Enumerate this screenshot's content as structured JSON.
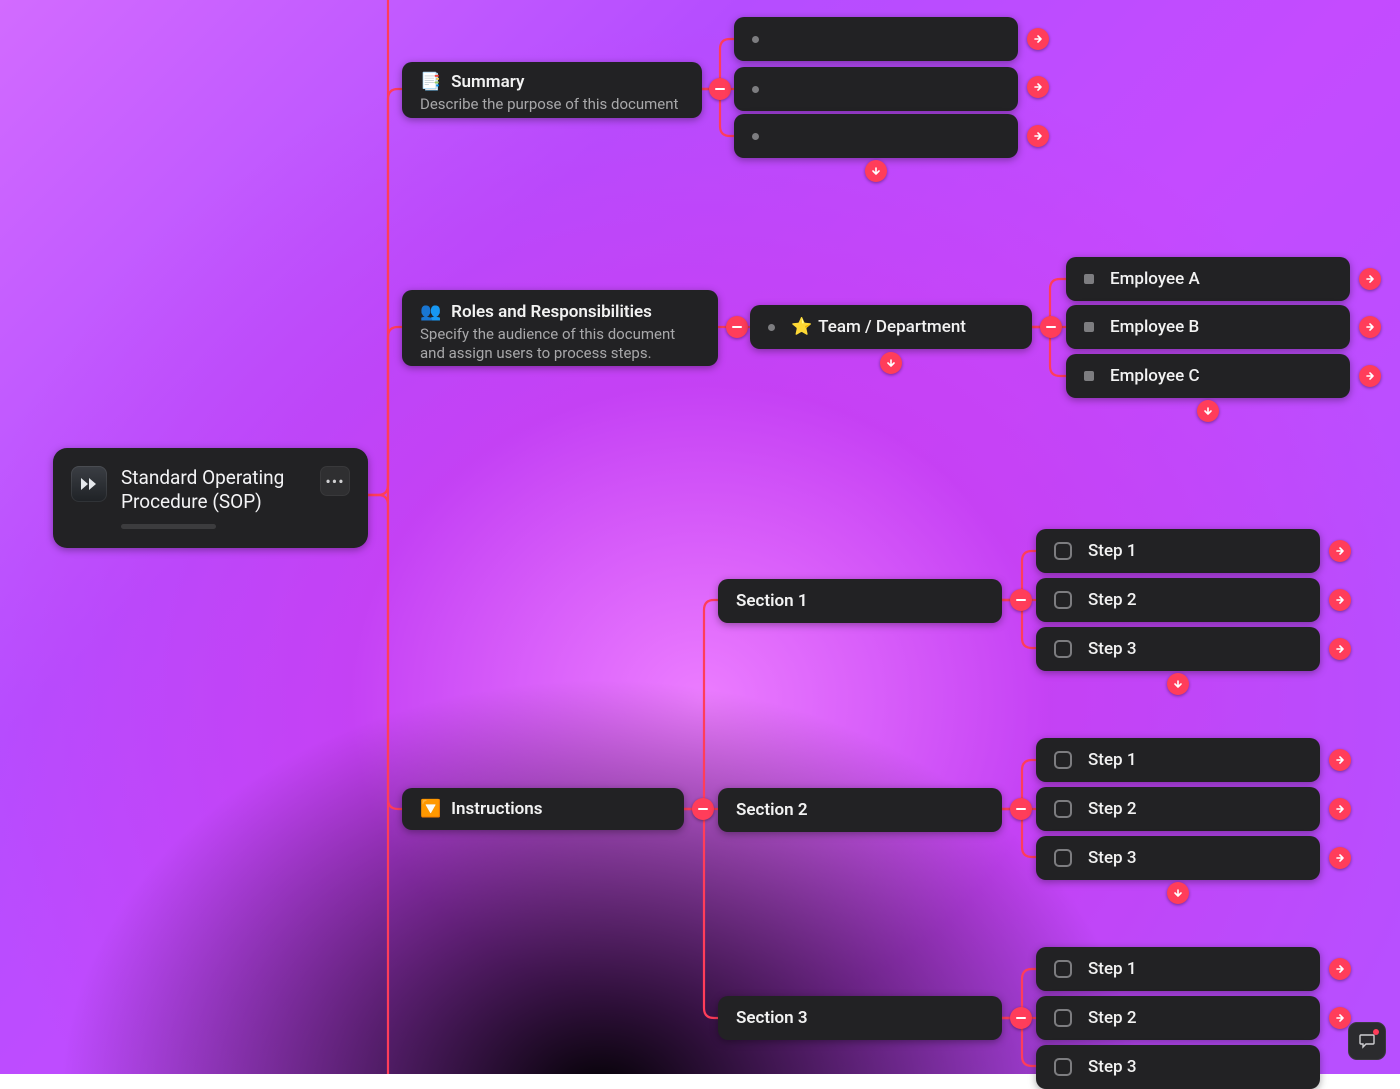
{
  "root": {
    "title": "Standard Operating Procedure (SOP)"
  },
  "summary": {
    "icon": "📑",
    "title": "Summary",
    "sub": "Describe the purpose of this document",
    "items": [
      "",
      "",
      ""
    ]
  },
  "roles": {
    "icon": "👥",
    "title": "Roles and Responsibilities",
    "sub": "Specify the audience of this document and assign users to process steps.",
    "team_icon": "⭐",
    "team_label": "Team / Department",
    "employees": [
      "Employee A",
      "Employee B",
      "Employee C"
    ]
  },
  "instructions": {
    "icon": "🔽",
    "title": "Instructions",
    "sections": [
      {
        "label": "Section 1",
        "steps": [
          "Step 1",
          "Step 2",
          "Step 3"
        ]
      },
      {
        "label": "Section 2",
        "steps": [
          "Step 1",
          "Step 2",
          "Step 3"
        ]
      },
      {
        "label": "Section 3",
        "steps": [
          "Step 1",
          "Step 2",
          "Step 3"
        ]
      }
    ]
  }
}
